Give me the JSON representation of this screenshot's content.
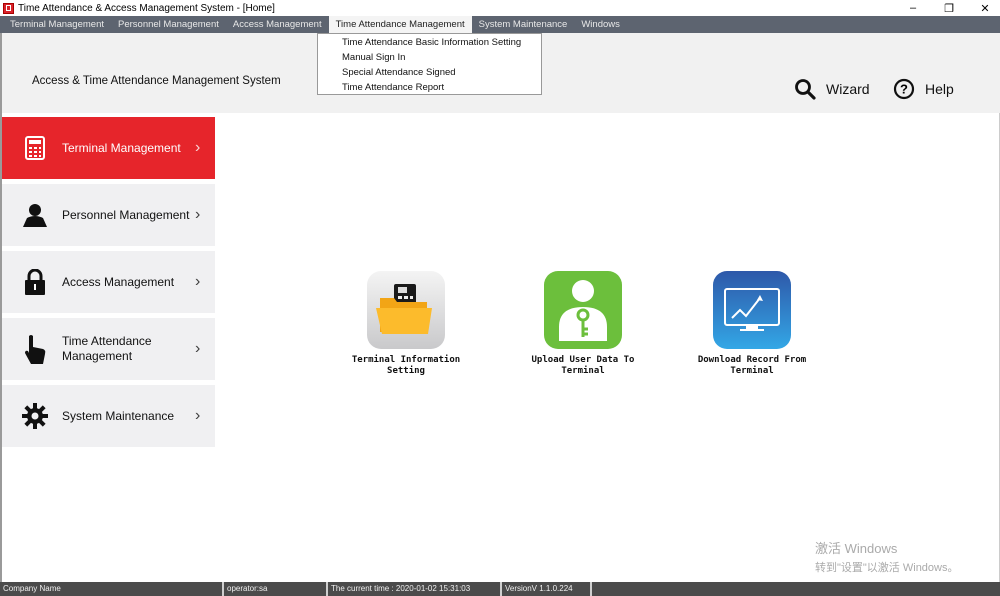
{
  "window": {
    "title": "Time Attendance & Access Management System - [Home]",
    "controls": [
      "minimize",
      "restore",
      "close"
    ]
  },
  "menu": {
    "items": [
      "Terminal Management",
      "Personnel Management",
      "Access Management",
      "Time Attendance Management",
      "System Maintenance",
      "Windows"
    ],
    "active": "Time Attendance Management",
    "dropdown": [
      "Time Attendance Basic Information Setting",
      "Manual Sign In",
      "Special Attendance Signed",
      "Time Attendance Report"
    ]
  },
  "header": {
    "system_name": "Access & Time Attendance Management System",
    "wizard": "Wizard",
    "help": "Help"
  },
  "sidebar": {
    "items": [
      {
        "label": "Terminal Management",
        "icon": "calculator-icon",
        "active": true
      },
      {
        "label": "Personnel Management",
        "icon": "person-icon"
      },
      {
        "label": "Access Management",
        "icon": "lock-icon"
      },
      {
        "label": "Time Attendance Management",
        "icon": "hand-pointer-icon"
      },
      {
        "label": "System Maintenance",
        "icon": "gear-icon"
      }
    ]
  },
  "tiles": [
    {
      "line1": "Terminal Information",
      "line2": "Setting",
      "icon": "terminal-folder-icon"
    },
    {
      "line1": "Upload User Data To",
      "line2": "Terminal",
      "icon": "user-key-icon"
    },
    {
      "line1": "Download Record From",
      "line2": "Terminal",
      "icon": "monitor-chart-icon"
    }
  ],
  "watermark": {
    "line1": "激活 Windows",
    "line2": "转到\"设置\"以激活 Windows。"
  },
  "status": {
    "company": "Company Name",
    "operator": "operator:sa",
    "time": "The current time :  2020-01-02 15:31:03",
    "version": "VersionV 1.1.0.224"
  },
  "colors": {
    "accent": "#e6252b",
    "menubar": "#5d6470",
    "statusbar": "#4b4b4b"
  }
}
